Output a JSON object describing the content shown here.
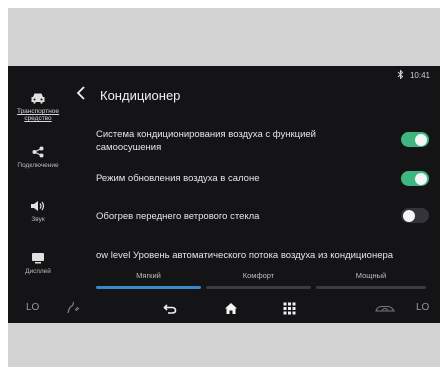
{
  "status": {
    "bluetooth_icon": "bluetooth-icon",
    "time": "10:41"
  },
  "sidebar": {
    "items": [
      {
        "label": "Транспортное средство",
        "icon": "car-icon",
        "active": true
      },
      {
        "label": "Подключение",
        "icon": "share-icon",
        "active": false
      },
      {
        "label": "Звук",
        "icon": "speaker-icon",
        "active": false
      },
      {
        "label": "Дисплей",
        "icon": "display-icon",
        "active": false
      }
    ]
  },
  "header": {
    "title": "Кондиционер"
  },
  "settings": [
    {
      "label": "Система кондиционирования воздуха с функцией самоосушения",
      "on": true
    },
    {
      "label": "Режим обновления воздуха в салоне",
      "on": true
    },
    {
      "label": "Обогрев переднего ветрового стекла",
      "on": false
    }
  ],
  "airflow": {
    "label": "ow level Уровень автоматического потока воздуха из кондиционера",
    "options": [
      "Мягкий",
      "Комфорт",
      "Мощный"
    ],
    "selected": "Мягкий"
  },
  "nav": {
    "left_temp": "LO",
    "right_temp": "LO"
  },
  "colors": {
    "accent": "#3fb67f",
    "screen_bg": "#141417",
    "selected_tab": "#3a86c8"
  }
}
